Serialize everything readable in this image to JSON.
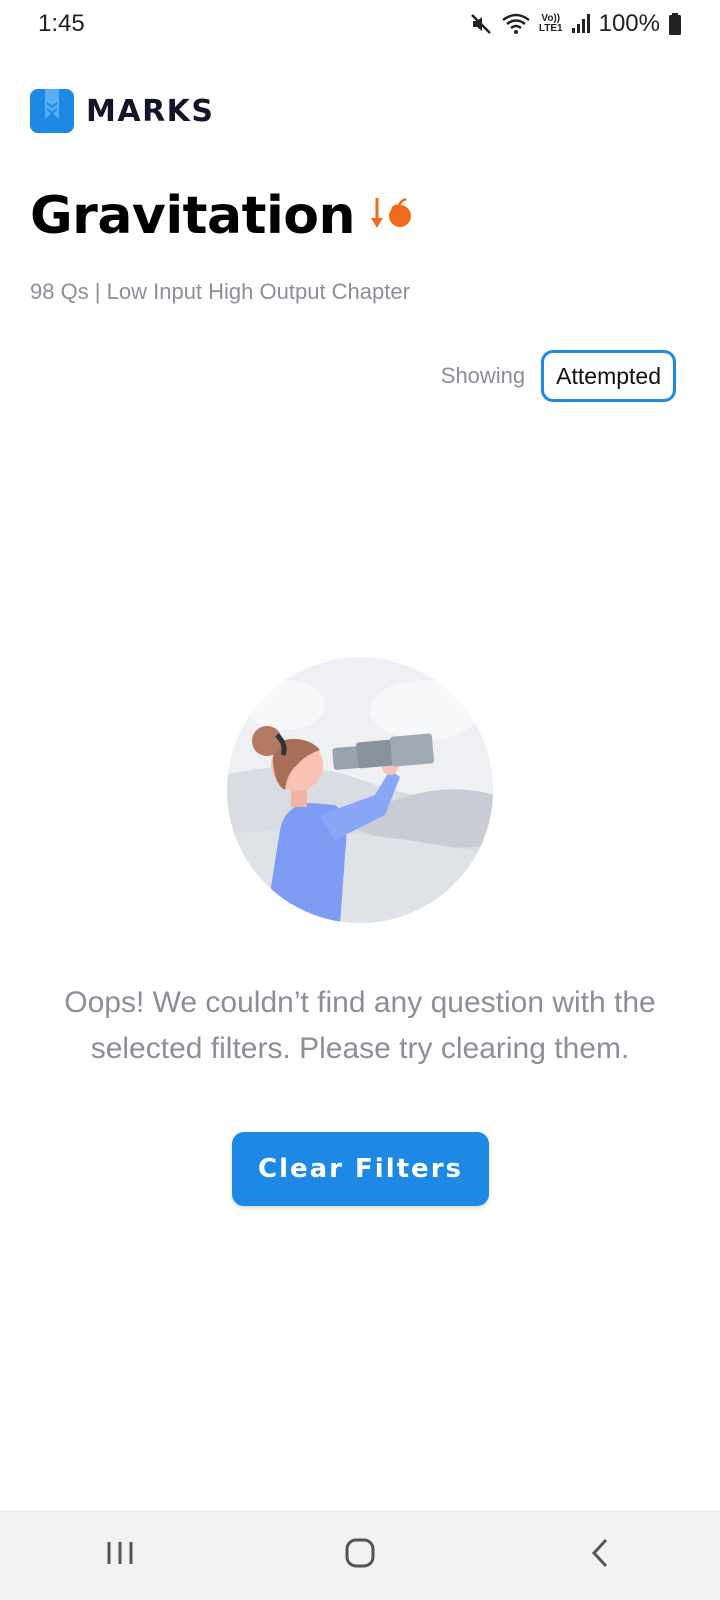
{
  "status_bar": {
    "time": "1:45",
    "battery": "100%",
    "network_label_top": "Vo))",
    "network_label_bottom": "LTE1",
    "icons": [
      "mute-icon",
      "wifi-icon",
      "volte-icon",
      "signal-icon",
      "battery-icon"
    ]
  },
  "brand": {
    "name": "MARKS",
    "logo_icon": "marks-logo-icon",
    "accent_color": "#1e88e5"
  },
  "chapter": {
    "title": "Gravitation",
    "badge_icon": "falling-apple-icon",
    "badge_color": "#f26a1b",
    "subtitle": "98 Qs | Low Input High Output Chapter"
  },
  "filter": {
    "showing_label": "Showing",
    "selected_value": "Attempted"
  },
  "empty_state": {
    "illustration_icon": "person-with-binoculars-illustration",
    "message": "Oops! We couldn’t find any question with the selected filters. Please try clearing them.",
    "button_label": "Clear Filters"
  },
  "nav_bar": {
    "recents_icon": "recents-icon",
    "home_icon": "home-icon",
    "back_icon": "back-icon"
  }
}
